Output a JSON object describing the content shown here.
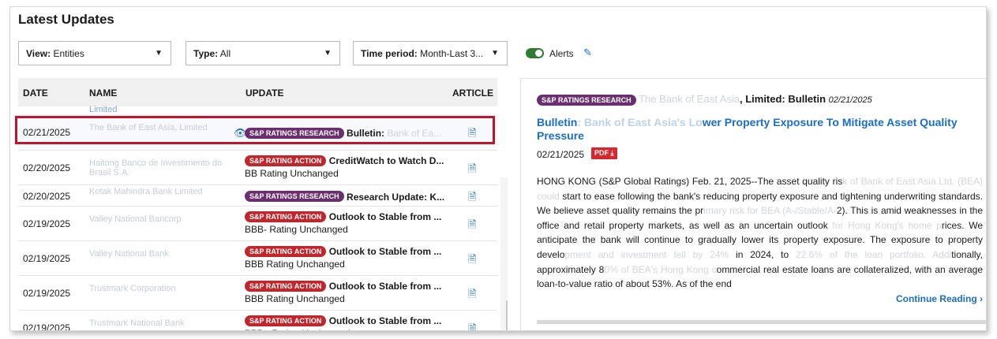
{
  "page": {
    "title": "Latest Updates"
  },
  "filters": {
    "view": {
      "label": "View:",
      "value": "Entities"
    },
    "type": {
      "label": "Type:",
      "value": "All"
    },
    "time": {
      "label": "Time period:",
      "value": "Month-Last 3..."
    }
  },
  "alerts": {
    "label": "Alerts",
    "enabled": true
  },
  "table": {
    "columns": [
      "DATE",
      "NAME",
      "UPDATE",
      "ARTICLE"
    ],
    "partial_row_name": "Limited",
    "rows": [
      {
        "date": "02/21/2025",
        "name": "The Bank of East Asia, Limited",
        "badge": "S&P RATINGS RESEARCH",
        "badge_type": "research",
        "title": "Bulletin:",
        "title_ghost": "Bank of Ea...",
        "sub": "",
        "selected": true
      },
      {
        "date": "02/20/2025",
        "name": "Haitong Banco de Investimento do Brasil S.A.",
        "badge": "S&P RATING ACTION",
        "badge_type": "action",
        "title": "CreditWatch to Watch D...",
        "title_ghost": "",
        "sub": "BB Rating Unchanged",
        "selected": false
      },
      {
        "date": "02/20/2025",
        "name": "Kotak Mahindra Bank Limited",
        "badge": "S&P RATINGS RESEARCH",
        "badge_type": "research",
        "title": "Research Update: K...",
        "title_ghost": "",
        "sub": "",
        "selected": false
      },
      {
        "date": "02/19/2025",
        "name": "Valley National Bancorp",
        "badge": "S&P RATING ACTION",
        "badge_type": "action",
        "title": "Outlook to Stable from ...",
        "title_ghost": "",
        "sub": "BBB- Rating Unchanged",
        "selected": false
      },
      {
        "date": "02/19/2025",
        "name": "Valley National Bank",
        "badge": "S&P RATING ACTION",
        "badge_type": "action",
        "title": "Outlook to Stable from ...",
        "title_ghost": "",
        "sub": "BBB Rating Unchanged",
        "selected": false
      },
      {
        "date": "02/19/2025",
        "name": "Trustmark Corporation",
        "badge": "S&P RATING ACTION",
        "badge_type": "action",
        "title": "Outlook to Stable from ...",
        "title_ghost": "",
        "sub": "BBB Rating Unchanged",
        "selected": false
      },
      {
        "date": "02/19/2025",
        "name": "Trustmark National Bank",
        "badge": "S&P RATING ACTION",
        "badge_type": "action",
        "title": "Outlook to Stable from ...",
        "title_ghost": "",
        "sub": "BBB+ Rating Unchanged",
        "selected": false
      }
    ]
  },
  "article": {
    "badge": "S&P RATINGS RESEARCH",
    "entity_ghost": "The Bank of East Asia",
    "entity_strong": ", Limited: Bulletin",
    "date_italic": "02/21/2025",
    "title_a": "Bulletin",
    "title_ghost": ": Bank of East Asia's Lo",
    "title_b": "wer Property Exposure To Mitigate Asset Quality Pressure",
    "date": "02/21/2025",
    "pdf_label": "PDF",
    "body": [
      {
        "t": "HONG KONG (S&P Global Ratings) Feb. 21, 2025--The asset quality ris",
        "g": false
      },
      {
        "t": "k of Bank of East Asia Ltd. (BEA) could ",
        "g": true
      },
      {
        "t": "start to ease following the bank's reducing property exposure and tightening underwriting standards. We believe asset quality remains the pr",
        "g": false
      },
      {
        "t": "imary risk for BEA (A-/Stable/A-",
        "g": true
      },
      {
        "t": "2). This is amid weaknesses in the office and retail property markets, as well as an uncertain outlook",
        "g": false
      },
      {
        "t": " for Hong Kong's home p",
        "g": true
      },
      {
        "t": "rices. We anticipate the bank will continue to gradually lower its property exposure. The exposure to property develo",
        "g": false
      },
      {
        "t": "pment and investment fell by 24% ",
        "g": true
      },
      {
        "t": "in 2024, to ",
        "g": false
      },
      {
        "t": "22.6% of the loan portfolio. Addi",
        "g": true
      },
      {
        "t": "tionally, approximately 8",
        "g": false
      },
      {
        "t": "0% of BEA's Hong Kong c",
        "g": true
      },
      {
        "t": "ommercial real estate loans are collateralized, with an average loan-to-value ratio of about 53%. As of the end",
        "g": false
      }
    ],
    "continue_label": "Continue Reading"
  }
}
